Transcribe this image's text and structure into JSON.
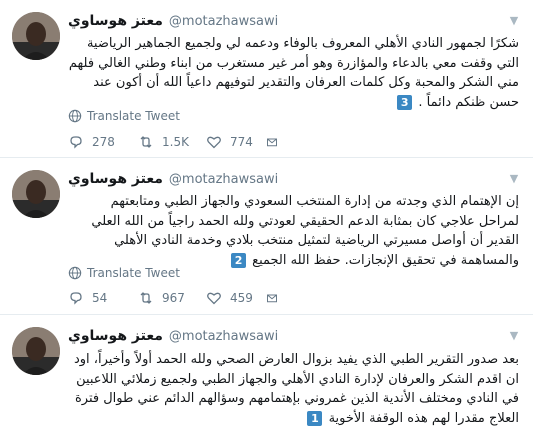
{
  "tweets": [
    {
      "author": "معتز هوساوي",
      "handle": "@motazhawsawi",
      "text": "شكرًا لجمهور النادي الأهلي المعروف بالوفاء ودعمه لي ولجميع الجماهير الرياضية التي وقفت معي بالدعاء والمؤازرة وهو أمر غير مستغرب من ابناء وطني الغالي فلهم مني الشكر والمحبة وكل كلمات العرفان والتقدير لتوفيهم داعياً الله أن أكون عند حسن ظنكم دائماً .",
      "badge": "3",
      "translate": "Translate Tweet",
      "replies": "278",
      "retweets": "1.5K",
      "likes": "774"
    },
    {
      "author": "معتز هوساوي",
      "handle": "@motazhawsawi",
      "text": "إن الإهتمام الذي وجدته من إدارة المنتخب السعودي والجهاز الطبي ومتابعتهم لمراحل علاجي كان بمثابة الدعم الحقيقي لعودتي ولله الحمد راجياً من الله العلي القدير أن أواصل مسيرتي الرياضية لتمثيل منتخب بلادي وخدمة النادي الأهلي والمساهمة في تحقيق الإنجازات. حفظ الله الجميع",
      "badge": "2",
      "translate": "Translate Tweet",
      "replies": "54",
      "retweets": "967",
      "likes": "459"
    },
    {
      "author": "معتز هوساوي",
      "handle": "@motazhawsawi",
      "text": "بعد صدور التقرير الطبي الذي يفيد بزوال العارض الصحي ولله الحمد أولاً وأخيراً، اود ان اقدم الشكر والعرفان لإدارة النادي الأهلي والجهاز الطبي ولجميع زملائي اللاعبين في النادي ومختلف الأندية الذين غمروني بإهتمامهم وسؤالهم الدائم عني طوال فترة العلاج مقدرا لهم هذه الوقفة الأخوية",
      "badge": "1"
    }
  ],
  "colors": {
    "text": "#14171a",
    "secondary": "#657786",
    "divider": "#e6ecf0",
    "badge": "#3b88c3"
  },
  "icons": [
    "chevron-down-icon",
    "globe-icon",
    "reply-icon",
    "retweet-icon",
    "like-icon",
    "direct-message-icon"
  ]
}
